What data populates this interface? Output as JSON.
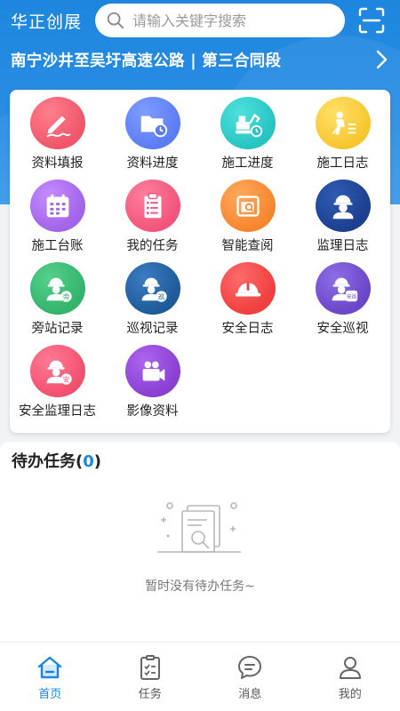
{
  "header": {
    "app_title": "华正创展",
    "search_placeholder": "请输入关键字搜索",
    "project_name": "南宁沙井至吴圩高速公路 | 第三合同段"
  },
  "grid": {
    "items": [
      {
        "label": "资料填报",
        "icon": "pen-icon",
        "color": "#f0556a"
      },
      {
        "label": "资料进度",
        "icon": "folder-clock-icon",
        "color": "#5b7cf5"
      },
      {
        "label": "施工进度",
        "icon": "excavator-icon",
        "color": "#27c4c2"
      },
      {
        "label": "施工日志",
        "icon": "worker-digging-icon",
        "color": "#f7c62f"
      },
      {
        "label": "施工台账",
        "icon": "calendar-icon",
        "color": "#a263e8"
      },
      {
        "label": "我的任务",
        "icon": "clipboard-list-icon",
        "color": "#f1547b"
      },
      {
        "label": "智能查阅",
        "icon": "document-search-icon",
        "color": "#f7852e"
      },
      {
        "label": "监理日志",
        "icon": "supervisor-icon",
        "color": "#1c3f8f"
      },
      {
        "label": "旁站记录",
        "icon": "worker-bystander-icon",
        "color": "#33b36b"
      },
      {
        "label": "巡视记录",
        "icon": "worker-patrol-icon",
        "color": "#1e5a99"
      },
      {
        "label": "安全日志",
        "icon": "safety-helmet-icon",
        "color": "#ef3f3f"
      },
      {
        "label": "安全巡视",
        "icon": "worker-safety-patrol-icon",
        "color": "#6b46c8"
      },
      {
        "label": "安全监理日志",
        "icon": "worker-safety-icon",
        "color": "#f24f6e"
      },
      {
        "label": "影像资料",
        "icon": "video-camera-icon",
        "color": "#8a3fd1"
      }
    ],
    "badges": {
      "bystander": "旁",
      "patrol": "巡",
      "safety_patrol": "安巡",
      "safety": "安"
    }
  },
  "todo": {
    "title": "待办任务",
    "count_open": "(",
    "count": "0",
    "count_close": ")",
    "empty_text": "暂时没有待办任务~"
  },
  "nav": {
    "items": [
      {
        "label": "首页",
        "icon": "home-icon",
        "active": true
      },
      {
        "label": "任务",
        "icon": "task-icon",
        "active": false
      },
      {
        "label": "消息",
        "icon": "message-icon",
        "active": false
      },
      {
        "label": "我的",
        "icon": "user-icon",
        "active": false
      }
    ],
    "active_color": "#1a86de",
    "inactive_color": "#555555"
  }
}
